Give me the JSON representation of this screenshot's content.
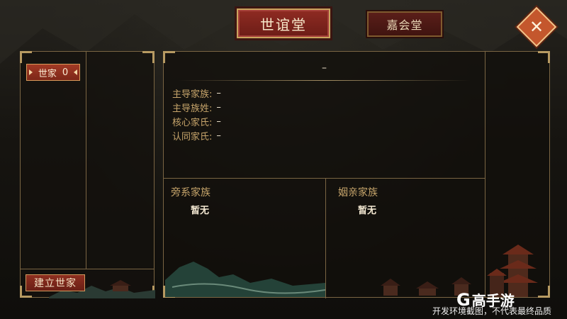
{
  "tabs": {
    "active_label": "世谊堂",
    "other_label": "嘉会堂"
  },
  "close": {
    "icon": "close-icon",
    "glyph": "✕"
  },
  "left_panel": {
    "family_label": "世家",
    "family_count": "0",
    "found_button_label": "建立世家"
  },
  "main_panel": {
    "title": "–",
    "info": [
      {
        "key": "主导家族:",
        "value": "–"
      },
      {
        "key": "主导族姓:",
        "value": "–"
      },
      {
        "key": "核心家氏:",
        "value": "–"
      },
      {
        "key": "认同家氏:",
        "value": "–"
      }
    ],
    "branch": {
      "title": "旁系家族",
      "value": "暂无"
    },
    "inlaw": {
      "title": "姻亲家族",
      "value": "暂无"
    }
  },
  "watermark": {
    "text": "开发环境截图，不代表最终品质",
    "logo_text": "高手游",
    "logo_mark": "G"
  },
  "colors": {
    "accent_red": "#8f2b22",
    "gold_border": "#c9a45e",
    "label_gold": "#c7a56b",
    "close_orange": "#c4572d"
  }
}
